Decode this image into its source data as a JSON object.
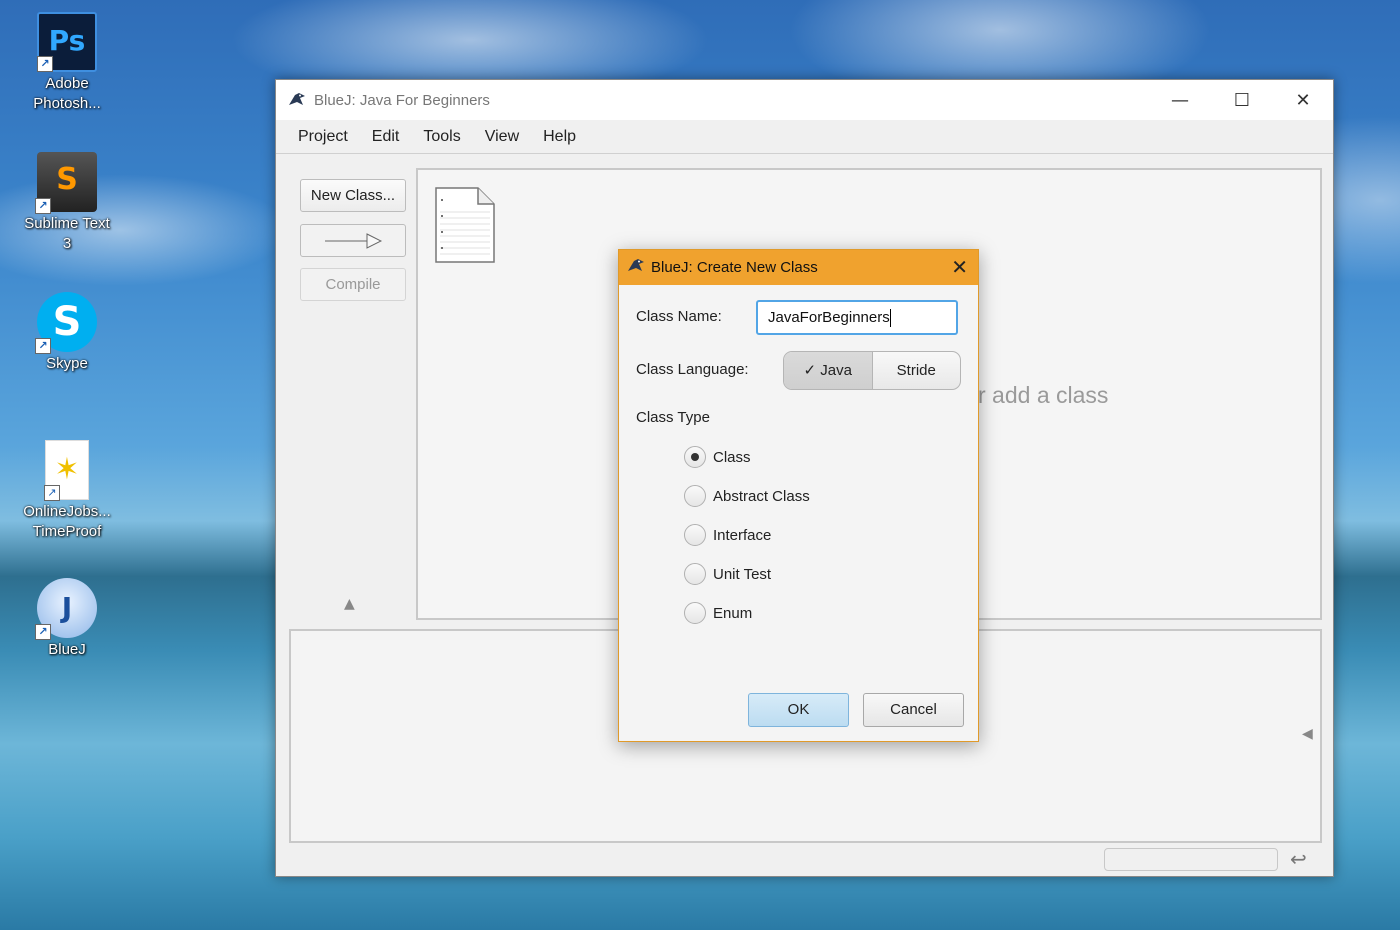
{
  "desktop": {
    "icons": [
      {
        "label_line1": "Adobe",
        "label_line2": "Photosh...",
        "glyph": "Ps",
        "icon": "photoshop-icon"
      },
      {
        "label_line1": "Sublime Text",
        "label_line2": "3",
        "glyph": "S",
        "icon": "sublime-text-icon"
      },
      {
        "label_line1": "Skype",
        "label_line2": "",
        "glyph": "S",
        "icon": "skype-icon"
      },
      {
        "label_line1": "OnlineJobs...",
        "label_line2": "TimeProof",
        "glyph": "✶",
        "icon": "onlinejobs-icon"
      },
      {
        "label_line1": "BlueJ",
        "label_line2": "",
        "glyph": "J",
        "icon": "bluej-icon"
      }
    ]
  },
  "window": {
    "title": "BlueJ:  Java For Beginners",
    "controls": {
      "minimize": "—",
      "maximize": "☐",
      "close": "✕"
    },
    "menu": [
      "Project",
      "Edit",
      "Tools",
      "View",
      "Help"
    ],
    "toolbar": {
      "new_class": "New Class...",
      "arrow": "——▷",
      "compile": "Compile"
    },
    "canvas_hint": "r add a class"
  },
  "dialog": {
    "title": "BlueJ:  Create New Class",
    "close": "✕",
    "class_name_label": "Class Name:",
    "class_name_value": "JavaForBeginners",
    "class_language_label": "Class Language:",
    "languages": [
      {
        "label": "✓  Java",
        "selected": true
      },
      {
        "label": "Stride",
        "selected": false
      }
    ],
    "class_type_label": "Class Type",
    "class_types": [
      {
        "label": "Class",
        "checked": true
      },
      {
        "label": "Abstract Class",
        "checked": false
      },
      {
        "label": "Interface",
        "checked": false
      },
      {
        "label": "Unit Test",
        "checked": false
      },
      {
        "label": "Enum",
        "checked": false
      }
    ],
    "ok": "OK",
    "cancel": "Cancel"
  },
  "colors": {
    "dialog_title_bg": "#f0a22e",
    "input_focus": "#52a5e6"
  }
}
